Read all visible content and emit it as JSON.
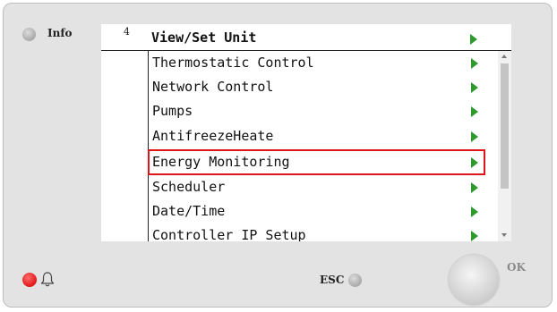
{
  "panel": {
    "info_label": "Info",
    "esc_label": "ESC",
    "ok_label": "OK"
  },
  "screen": {
    "page_number": "4",
    "title": "View/Set Unit",
    "menu_items": [
      {
        "label": "Thermostatic Control"
      },
      {
        "label": "Network Control"
      },
      {
        "label": "Pumps"
      },
      {
        "label": "AntifreezeHeate"
      },
      {
        "label": "Energy Monitoring",
        "selected": true
      },
      {
        "label": "Scheduler"
      },
      {
        "label": "Date/Time"
      },
      {
        "label": "Controller IP Setup"
      }
    ]
  },
  "colors": {
    "selection_border": "#e0151b",
    "arrow": "#2e9a2e",
    "alarm_led": "#e01818"
  },
  "icons": {
    "info_led": "gray-led-icon",
    "esc_led": "gray-led-icon",
    "alarm_led": "red-led-icon",
    "bell": "bell-icon",
    "submenu": "green-arrow-right-icon"
  }
}
